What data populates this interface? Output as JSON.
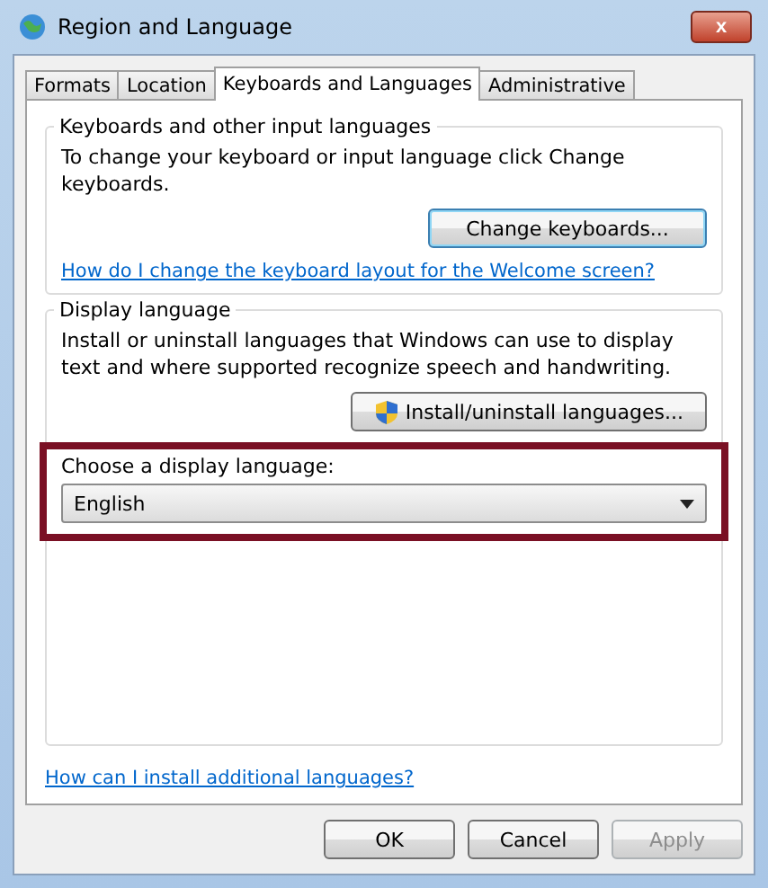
{
  "window": {
    "title": "Region and Language",
    "close_label": "x"
  },
  "tabs": [
    {
      "label": "Formats",
      "selected": false
    },
    {
      "label": "Location",
      "selected": false
    },
    {
      "label": "Keyboards and Languages",
      "selected": true
    },
    {
      "label": "Administrative",
      "selected": false
    }
  ],
  "keyboards_group": {
    "legend": "Keyboards and other input languages",
    "description": "To change your keyboard or input language click Change keyboards.",
    "button": "Change keyboards...",
    "link": "How do I change the keyboard layout for the Welcome screen?"
  },
  "display_group": {
    "legend": "Display language",
    "description": "Install or uninstall languages that Windows can use to display text and where supported recognize speech and handwriting.",
    "button": "Install/uninstall languages...",
    "choose_label": "Choose a display language:",
    "dropdown_value": "English",
    "highlighted": true
  },
  "help_link": "How can I install additional languages?",
  "buttons": [
    {
      "label": "OK",
      "disabled": false
    },
    {
      "label": "Cancel",
      "disabled": false
    },
    {
      "label": "Apply",
      "disabled": true
    }
  ]
}
